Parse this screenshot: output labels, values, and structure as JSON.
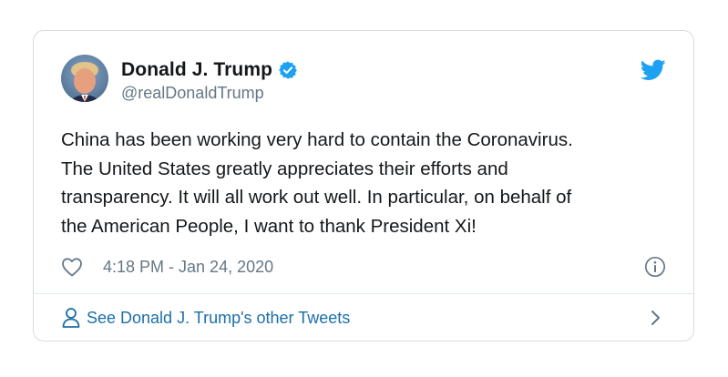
{
  "tweet": {
    "author": {
      "display_name": "Donald J. Trump",
      "handle": "@realDonaldTrump",
      "verified": true,
      "avatar_icon": "profile-photo"
    },
    "brand_icon": "twitter-bird-icon",
    "text": "China has been working very hard to contain the Coronavirus.\nThe United States greatly appreciates their efforts and\ntransparency. It will all work out well. In particular, on behalf of\nthe American People, I want to thank President Xi!",
    "timestamp": "4:18 PM - Jan 24, 2020",
    "like_icon": "heart-icon",
    "info_icon": "info-icon"
  },
  "footer": {
    "link_label": "See Donald J. Trump's other Tweets",
    "person_icon": "person-icon",
    "chevron_icon": "chevron-right-icon"
  },
  "colors": {
    "twitter_blue": "#1da1f2",
    "link_blue": "#1b6fa8",
    "text_dark": "#14171a",
    "text_gray": "#657786",
    "border": "#d8dde1"
  }
}
